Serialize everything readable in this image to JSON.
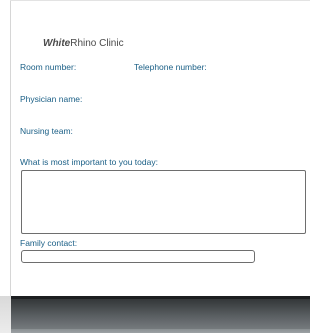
{
  "clinic": {
    "name_italic": "White",
    "name_rhino": "Rhino",
    "name_rest": " Clinic"
  },
  "form": {
    "room_number_label": "Room number:",
    "telephone_label": "Telephone number:",
    "physician_label": "Physician name:",
    "nursing_label": "Nursing team:",
    "important_label": "What is most important to you today:",
    "important_value": "",
    "family_label": "Family contact:",
    "family_value": ""
  },
  "colors": {
    "label_blue": "#1a5f86",
    "logo_gray": "#4a4a4a",
    "border_gray": "#6e6e6e"
  }
}
